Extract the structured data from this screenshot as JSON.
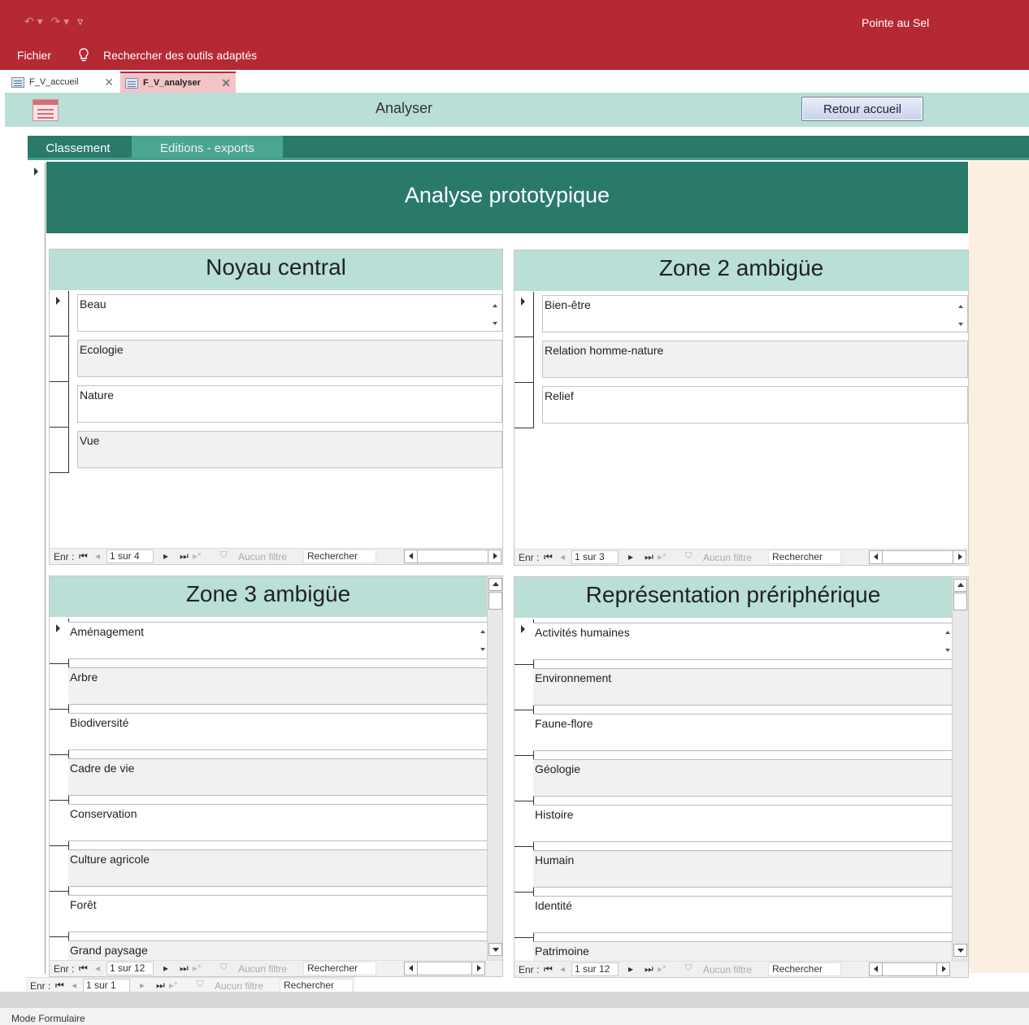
{
  "titlebar": {
    "undo_icon": "undo-icon",
    "redo_icon": "redo-icon",
    "title": "Pointe au Sel"
  },
  "menu": {
    "file": "Fichier",
    "search": "Rechercher des outils adaptés"
  },
  "doc_tabs": [
    {
      "label": "F_V_accueil"
    },
    {
      "label": "F_V_analyser"
    }
  ],
  "form": {
    "title": "Analyser",
    "back_button": "Retour accueil"
  },
  "tabs": [
    {
      "label": "Classement"
    },
    {
      "label": "Editions - exports"
    }
  ],
  "main_title": "Analyse prototypique",
  "panels": {
    "noyau": {
      "title": "Noyau central",
      "items": [
        "Beau",
        "Ecologie",
        "Nature",
        "Vue"
      ],
      "nav": {
        "label": "Enr :",
        "current": "1 sur 4",
        "filter": "Aucun filtre",
        "search": "Rechercher"
      }
    },
    "zone2": {
      "title": "Zone 2 ambigüe",
      "items": [
        "Bien-être",
        "Relation homme-nature",
        "Relief"
      ],
      "nav": {
        "label": "Enr :",
        "current": "1 sur 3",
        "filter": "Aucun filtre",
        "search": "Rechercher"
      }
    },
    "zone3": {
      "title": "Zone 3 ambigüe",
      "items": [
        "Aménagement",
        "Arbre",
        "Biodiversité",
        "Cadre de vie",
        "Conservation",
        "Culture agricole",
        "Forêt",
        "Grand paysage"
      ],
      "nav": {
        "label": "Enr :",
        "current": "1 sur 12",
        "filter": "Aucun filtre",
        "search": "Rechercher"
      }
    },
    "periph": {
      "title": "Représentation prériphérique",
      "items": [
        "Activités humaines",
        "Environnement",
        "Faune-flore",
        "Géologie",
        "Histoire",
        "Humain",
        "Identité",
        "Patrimoine"
      ],
      "nav": {
        "label": "Enr :",
        "current": "1 sur 12",
        "filter": "Aucun filtre",
        "search": "Rechercher"
      }
    }
  },
  "main_nav": {
    "label": "Enr :",
    "current": "1 sur 1",
    "filter": "Aucun filtre",
    "search": "Rechercher"
  },
  "status": "Mode Formulaire"
}
